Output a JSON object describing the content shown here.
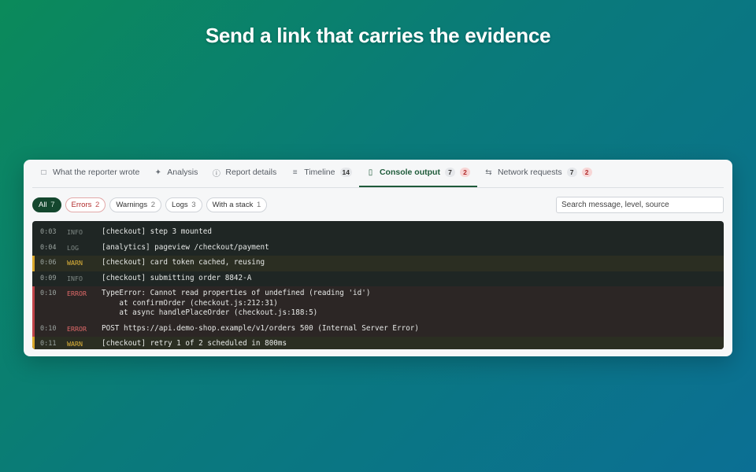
{
  "headline": "Send a link that carries the evidence",
  "tabs": [
    {
      "label": "What the reporter wrote",
      "icon": "chat-bubble-icon"
    },
    {
      "label": "Analysis",
      "icon": "sparkle-icon"
    },
    {
      "label": "Report details",
      "icon": "info-circle-icon"
    },
    {
      "label": "Timeline",
      "icon": "list-icon",
      "count": "14"
    },
    {
      "label": "Console output",
      "icon": "terminal-icon",
      "count": "7",
      "errors": "2",
      "active": true
    },
    {
      "label": "Network requests",
      "icon": "network-icon",
      "count": "7",
      "errors": "2"
    }
  ],
  "filters": [
    {
      "label": "All",
      "count": "7",
      "active": true
    },
    {
      "label": "Errors",
      "count": "2"
    },
    {
      "label": "Warnings",
      "count": "2"
    },
    {
      "label": "Logs",
      "count": "3"
    },
    {
      "label": "With a stack",
      "count": "1"
    }
  ],
  "search": {
    "placeholder": "Search message, level, source"
  },
  "console": [
    {
      "time": "0:03",
      "level": "INFO",
      "message": "[checkout] step 3 mounted"
    },
    {
      "time": "0:04",
      "level": "LOG",
      "message": "[analytics] pageview /checkout/payment"
    },
    {
      "time": "0:06",
      "level": "WARN",
      "message": "[checkout] card token cached, reusing"
    },
    {
      "time": "0:09",
      "level": "INFO",
      "message": "[checkout] submitting order 8842-A"
    },
    {
      "time": "0:10",
      "level": "ERROR",
      "message": "TypeError: Cannot read properties of undefined (reading 'id')\n    at confirmOrder (checkout.js:212:31)\n    at async handlePlaceOrder (checkout.js:188:5)"
    },
    {
      "time": "0:10",
      "level": "ERROR",
      "message": "POST https://api.demo-shop.example/v1/orders 500 (Internal Server Error)"
    },
    {
      "time": "0:11",
      "level": "WARN",
      "message": "[checkout] retry 1 of 2 scheduled in 800ms"
    }
  ],
  "colors": {
    "accent": "#1f5b3a",
    "warn": "#d9a72a",
    "error": "#c0444a",
    "console_bg": "#1f2624"
  }
}
